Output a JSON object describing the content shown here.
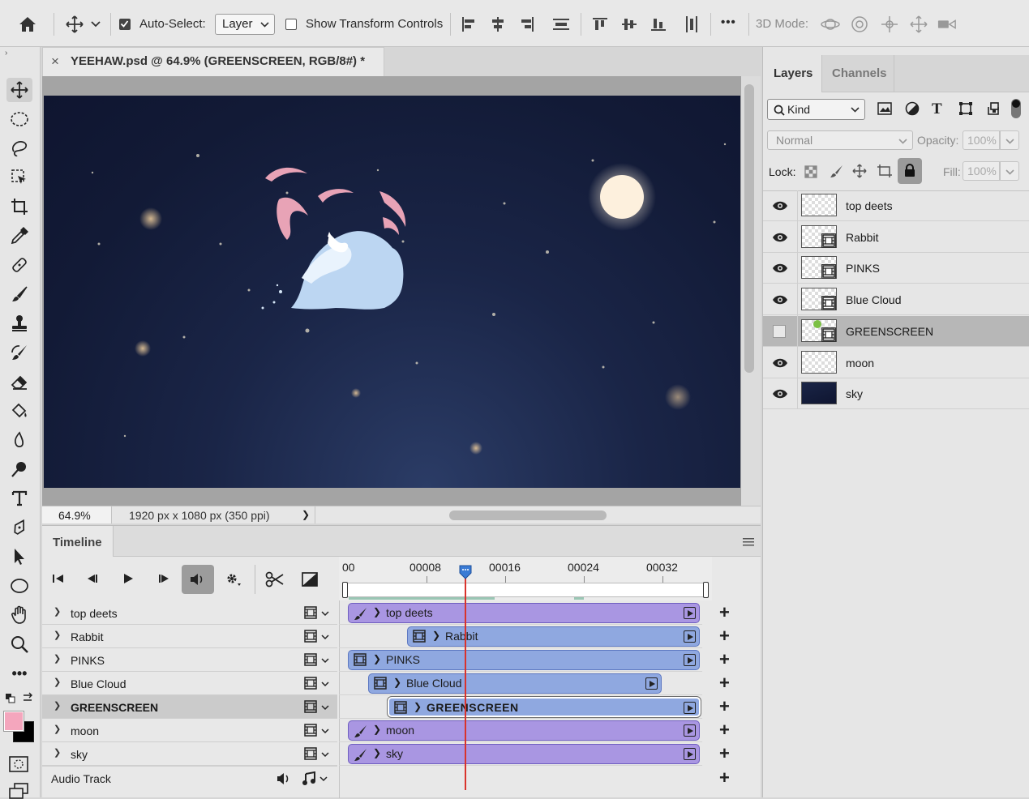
{
  "options_bar": {
    "auto_select_label": "Auto-Select:",
    "auto_select_value": "Layer",
    "show_transform_label": "Show Transform Controls",
    "three_d_mode_label": "3D Mode:",
    "more_label": "•••"
  },
  "document": {
    "tab_title": "YEEHAW.psd @ 64.9% (GREENSCREEN, RGB/8#) *",
    "close_glyph": "×",
    "zoom": "64.9%",
    "doc_size": "1920 px x 1080 px (350 ppi)",
    "status_arrow": "❯"
  },
  "timeline": {
    "title": "Timeline",
    "ruler_labels": [
      "00",
      "00008",
      "00016",
      "00024",
      "00032"
    ],
    "tracks": [
      {
        "name": "top deets",
        "clip": "top deets",
        "clip_type": "purple"
      },
      {
        "name": "Rabbit",
        "clip": "Rabbit",
        "clip_type": "blue"
      },
      {
        "name": "PINKS",
        "clip": "PINKS",
        "clip_type": "blue"
      },
      {
        "name": "Blue Cloud",
        "clip": "Blue Cloud",
        "clip_type": "blue"
      },
      {
        "name": "GREENSCREEN",
        "clip": "GREENSCREEN",
        "clip_type": "blue",
        "selected": true
      },
      {
        "name": "moon",
        "clip": "moon",
        "clip_type": "purple"
      },
      {
        "name": "sky",
        "clip": "sky",
        "clip_type": "purple"
      }
    ],
    "audio_track": "Audio Track"
  },
  "layers_panel": {
    "tabs": [
      "Layers",
      "Channels"
    ],
    "filter_kind": "Kind",
    "blend_mode": "Normal",
    "opacity_label": "Opacity:",
    "opacity_value": "100%",
    "lock_label": "Lock:",
    "fill_label": "Fill:",
    "fill_value": "100%",
    "layers": [
      {
        "name": "top deets",
        "visible": true,
        "smart": false
      },
      {
        "name": "Rabbit",
        "visible": true,
        "smart": true
      },
      {
        "name": "PINKS",
        "visible": true,
        "smart": true
      },
      {
        "name": "Blue Cloud",
        "visible": true,
        "smart": true
      },
      {
        "name": "GREENSCREEN",
        "visible": false,
        "smart": true,
        "selected": true
      },
      {
        "name": "moon",
        "visible": true,
        "smart": false
      },
      {
        "name": "sky",
        "visible": true,
        "smart": false,
        "dark": true
      }
    ]
  },
  "colors": {
    "foreground": "#f4a6bd",
    "background": "#000000",
    "playhead": "#3a7bd5",
    "clip_purple": "#a996e2",
    "clip_blue": "#8fa8e0"
  }
}
